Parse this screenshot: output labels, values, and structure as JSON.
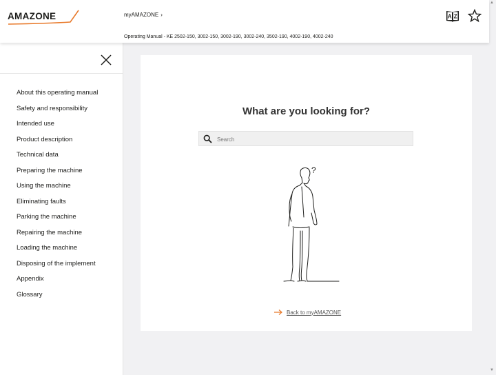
{
  "header": {
    "logo_text": "AMAZONE",
    "breadcrumb_label": "myAMAZONE",
    "breadcrumb_separator": "›",
    "document_title": "Operating Manual - KE 2502-150, 3002-150, 3002-190, 3002-240, 3502-190, 4002-190, 4002-240",
    "book_icon": "az-glossary-book-icon",
    "star_icon": "star-outline-icon"
  },
  "sidebar": {
    "close_icon": "close-icon",
    "items": [
      {
        "label": "About this operating manual"
      },
      {
        "label": "Safety and responsibility"
      },
      {
        "label": "Intended use"
      },
      {
        "label": "Product description"
      },
      {
        "label": "Technical data"
      },
      {
        "label": "Preparing the machine"
      },
      {
        "label": "Using the machine"
      },
      {
        "label": "Eliminating faults"
      },
      {
        "label": "Parking the machine"
      },
      {
        "label": "Repairing the machine"
      },
      {
        "label": "Loading the machine"
      },
      {
        "label": "Disposing of the implement"
      },
      {
        "label": "Appendix"
      },
      {
        "label": "Glossary"
      }
    ]
  },
  "main": {
    "title": "What are you looking for?",
    "search": {
      "placeholder": "Search",
      "value": ""
    },
    "illustration_mark": "?",
    "back_link_label": "Back to myAMAZONE"
  },
  "colors": {
    "brand_orange": "#e8792a",
    "text": "#1d1d1b",
    "page_background": "#f1f1f3"
  }
}
